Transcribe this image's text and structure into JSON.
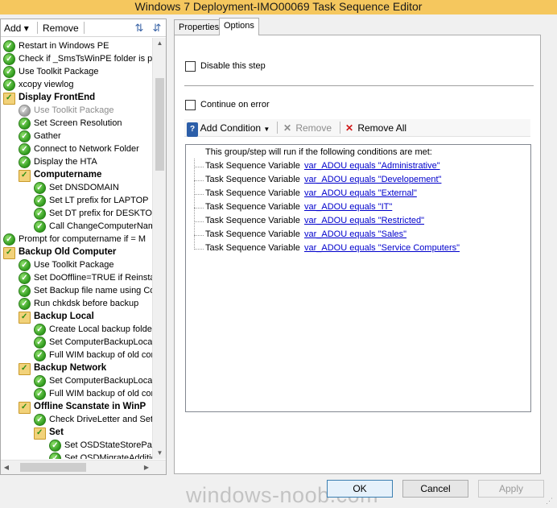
{
  "window": {
    "title": "Windows 7 Deployment-IMO00069 Task Sequence Editor"
  },
  "left_toolbar": {
    "add_label": "Add",
    "add_arrow": "▾",
    "remove_label": "Remove"
  },
  "tree": [
    {
      "label": "Restart in Windows PE",
      "kind": "step",
      "level": 0
    },
    {
      "label": "Check if _SmsTsWinPE folder is pre",
      "kind": "step",
      "level": 0
    },
    {
      "label": "Use Toolkit Package",
      "kind": "step",
      "level": 0
    },
    {
      "label": "xcopy viewlog",
      "kind": "step",
      "level": 0
    },
    {
      "label": "Display FrontEnd",
      "kind": "group",
      "level": 0
    },
    {
      "label": "Use Toolkit Package",
      "kind": "disabled",
      "level": 1
    },
    {
      "label": "Set Screen Resolution",
      "kind": "step",
      "level": 1
    },
    {
      "label": "Gather",
      "kind": "step",
      "level": 1
    },
    {
      "label": "Connect to Network Folder",
      "kind": "step",
      "level": 1
    },
    {
      "label": "Display the HTA",
      "kind": "step",
      "level": 1
    },
    {
      "label": "Computername",
      "kind": "group",
      "level": 1
    },
    {
      "label": "Set DNSDOMAIN",
      "kind": "step",
      "level": 2
    },
    {
      "label": "Set LT prefix for LAPTOP",
      "kind": "step",
      "level": 2
    },
    {
      "label": "Set DT prefix for DESKTOP",
      "kind": "step",
      "level": 2
    },
    {
      "label": "Call ChangeComputerName",
      "kind": "step",
      "level": 2
    },
    {
      "label": "Prompt for computername if = M",
      "kind": "step",
      "level": 0
    },
    {
      "label": "Backup Old Computer",
      "kind": "group",
      "level": 0
    },
    {
      "label": "Use Toolkit Package",
      "kind": "step",
      "level": 1
    },
    {
      "label": "Set DoOffline=TRUE if Reinstal",
      "kind": "step",
      "level": 1
    },
    {
      "label": "Set Backup file name using Cor",
      "kind": "step",
      "level": 1
    },
    {
      "label": "Run chkdsk before backup",
      "kind": "step",
      "level": 1
    },
    {
      "label": "Backup Local",
      "kind": "group",
      "level": 1
    },
    {
      "label": "Create Local backup folder",
      "kind": "step",
      "level": 2
    },
    {
      "label": "Set ComputerBackupLocat",
      "kind": "step",
      "level": 2
    },
    {
      "label": "Full WIM backup of old cor",
      "kind": "step",
      "level": 2
    },
    {
      "label": "Backup Network",
      "kind": "group",
      "level": 1
    },
    {
      "label": "Set ComputerBackupLocat",
      "kind": "step",
      "level": 2
    },
    {
      "label": "Full WIM backup of old cor",
      "kind": "step",
      "level": 2
    },
    {
      "label": "Offline Scanstate in WinP",
      "kind": "group",
      "level": 1
    },
    {
      "label": "Check DriveLetter and Set",
      "kind": "step",
      "level": 2
    },
    {
      "label": "Set",
      "kind": "group",
      "level": 2
    },
    {
      "label": "Set OSDStateStorePatl",
      "kind": "step",
      "level": 3
    },
    {
      "label": "Set OSDMigrateAdditio",
      "kind": "step",
      "level": 3
    }
  ],
  "tabs": [
    {
      "label": "Properties"
    },
    {
      "label": "Options"
    }
  ],
  "options": {
    "disable_step_label": "Disable this step",
    "continue_on_error_label": "Continue on error",
    "add_condition_label": "Add Condition",
    "remove_label": "Remove",
    "remove_all_label": "Remove All",
    "conditions_header": "This group/step will run if the following conditions are met:",
    "conditions": [
      {
        "type": "Task Sequence Variable",
        "expr": "var_ADOU equals \"Administrative\""
      },
      {
        "type": "Task Sequence Variable",
        "expr": "var_ADOU equals \"Developement\""
      },
      {
        "type": "Task Sequence Variable",
        "expr": "var_ADOU equals \"External\""
      },
      {
        "type": "Task Sequence Variable",
        "expr": "var_ADOU equals \"IT\""
      },
      {
        "type": "Task Sequence Variable",
        "expr": "var_ADOU equals \"Restricted\""
      },
      {
        "type": "Task Sequence Variable",
        "expr": "var_ADOU equals \"Sales\""
      },
      {
        "type": "Task Sequence Variable",
        "expr": "var_ADOU equals \"Service Computers\""
      }
    ]
  },
  "buttons": {
    "ok": "OK",
    "cancel": "Cancel",
    "apply": "Apply"
  },
  "watermark": "windows-noob.com"
}
